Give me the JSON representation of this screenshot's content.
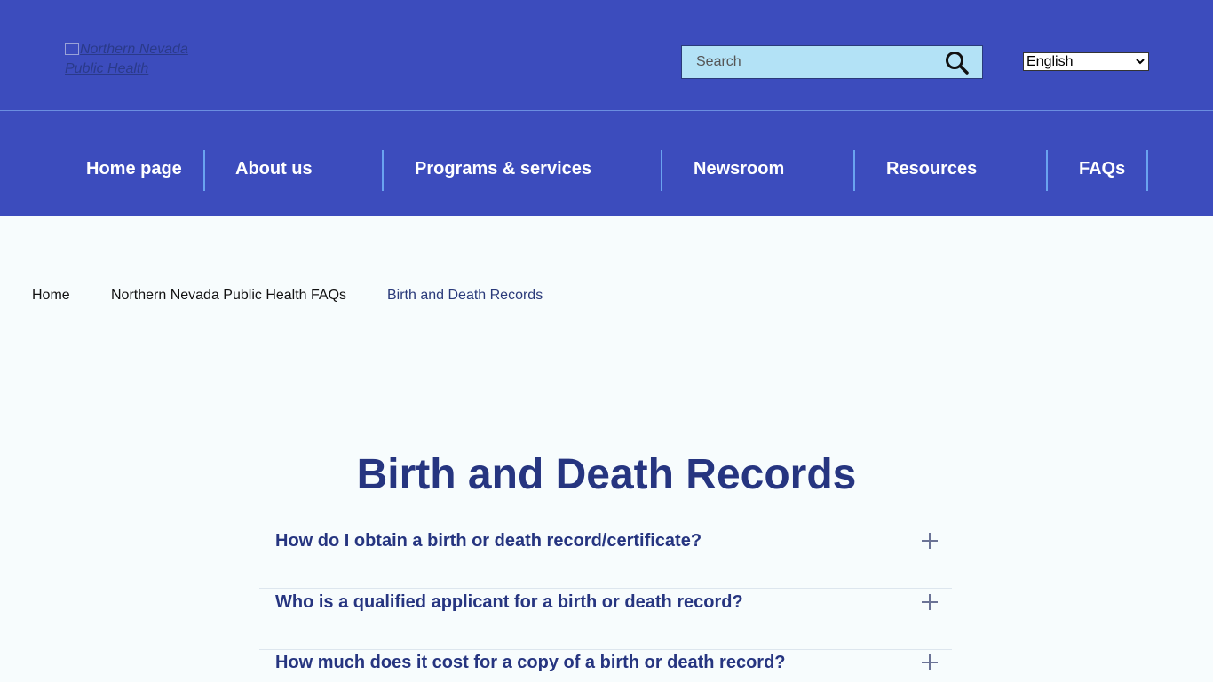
{
  "header": {
    "logo_alt": "Northern Nevada Public Health",
    "search_placeholder": "Search",
    "language": "English"
  },
  "nav": {
    "items": [
      {
        "label": "Home page"
      },
      {
        "label": "About us"
      },
      {
        "label": "Programs & services"
      },
      {
        "label": "Newsroom"
      },
      {
        "label": "Resources"
      },
      {
        "label": "FAQs"
      }
    ]
  },
  "breadcrumb": {
    "items": [
      {
        "label": "Home"
      },
      {
        "label": "Northern Nevada Public Health FAQs"
      },
      {
        "label": "Birth and Death Records"
      }
    ]
  },
  "main": {
    "title": "Birth and Death Records",
    "faqs": [
      {
        "question": "How do I obtain a birth or death record/certificate?"
      },
      {
        "question": "Who is a qualified applicant for a birth or death record?"
      },
      {
        "question": "How much does it cost for a copy of a birth or death record?"
      }
    ]
  },
  "colors": {
    "header_bg": "#3c4cbd",
    "search_bg": "#b3e2f6",
    "heading": "#263580",
    "nav_divider": "#6aa3f0",
    "page_bg": "#f7fcfd"
  },
  "icons": {
    "search": "search-icon",
    "expand": "plus-icon",
    "dropdown": "chevron-down-icon"
  }
}
